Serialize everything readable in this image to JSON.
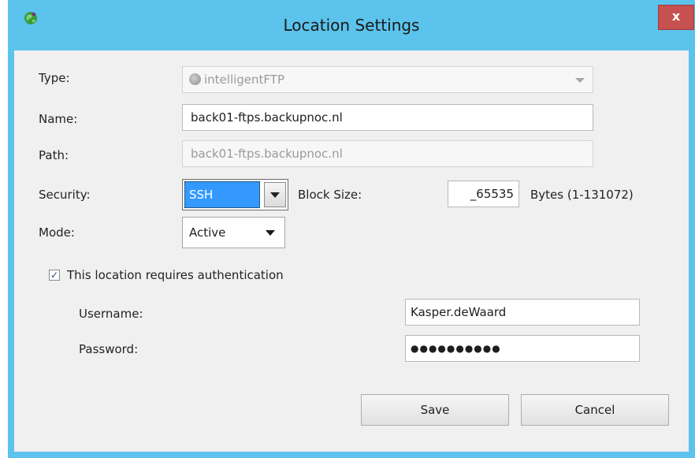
{
  "window": {
    "title": "Location Settings",
    "close_label": "x",
    "accent_color": "#5bc3ec",
    "app_icon": "globe-icon"
  },
  "form": {
    "type": {
      "label": "Type:",
      "value": "intelligentFTP",
      "icon": "globe-icon"
    },
    "name": {
      "label": "Name:",
      "value": "back01-ftps.backupnoc.nl"
    },
    "path": {
      "label": "Path:",
      "value": "back01-ftps.backupnoc.nl"
    },
    "security": {
      "label": "Security:",
      "value": "SSH"
    },
    "block_size": {
      "label": "Block Size:",
      "value": "_65535",
      "unit": "Bytes (1-131072)"
    },
    "mode": {
      "label": "Mode:",
      "value": "Active"
    }
  },
  "auth": {
    "checkbox_label": "This location requires authentication",
    "checked": true,
    "username_label": "Username:",
    "username_value": "Kasper.deWaard",
    "password_label": "Password:",
    "password_value": "●●●●●●●●●●"
  },
  "buttons": {
    "save": "Save",
    "cancel": "Cancel"
  }
}
